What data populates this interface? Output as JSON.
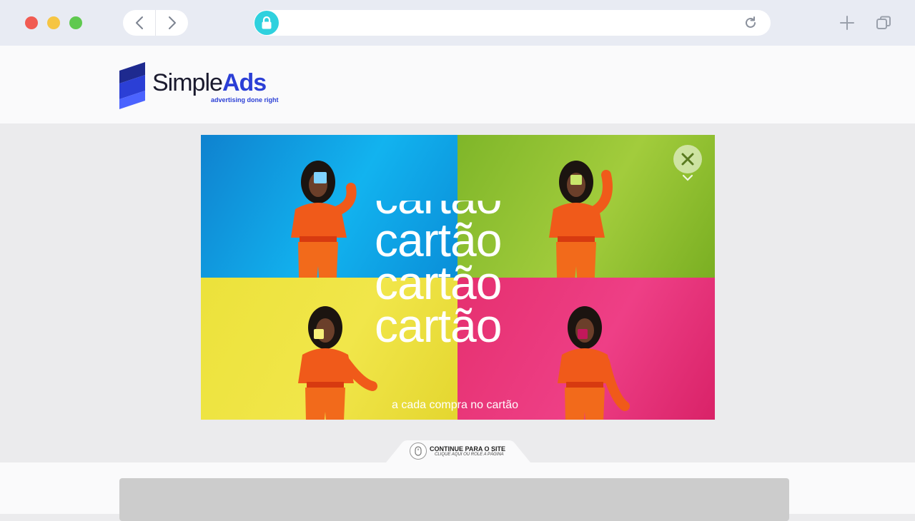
{
  "browser": {
    "url": "",
    "colors": {
      "chrome_bg": "#e8ebf3",
      "lock_accent": "#2fd1de"
    },
    "icons": [
      "close-dot",
      "minimize-dot",
      "maximize-dot",
      "back-arrow-icon",
      "forward-arrow-icon",
      "lock-icon",
      "reload-icon",
      "new-tab-icon",
      "tabs-icon"
    ]
  },
  "header": {
    "logo_simple": "Simple",
    "logo_ads": "Ads",
    "logo_tagline": "advertising done right",
    "brand_color": "#2b3fd6"
  },
  "ad": {
    "big_word": "cartão",
    "subtitle": "a cada compra no cartão",
    "panel_colors": [
      "#12b3ef",
      "#a2cc3c",
      "#f1e64a",
      "#ee3f86"
    ]
  },
  "continue": {
    "title": "CONTINUE PARA O SITE",
    "subtitle": "CLIQUE AQUI OU ROLE A PÁGINA"
  }
}
